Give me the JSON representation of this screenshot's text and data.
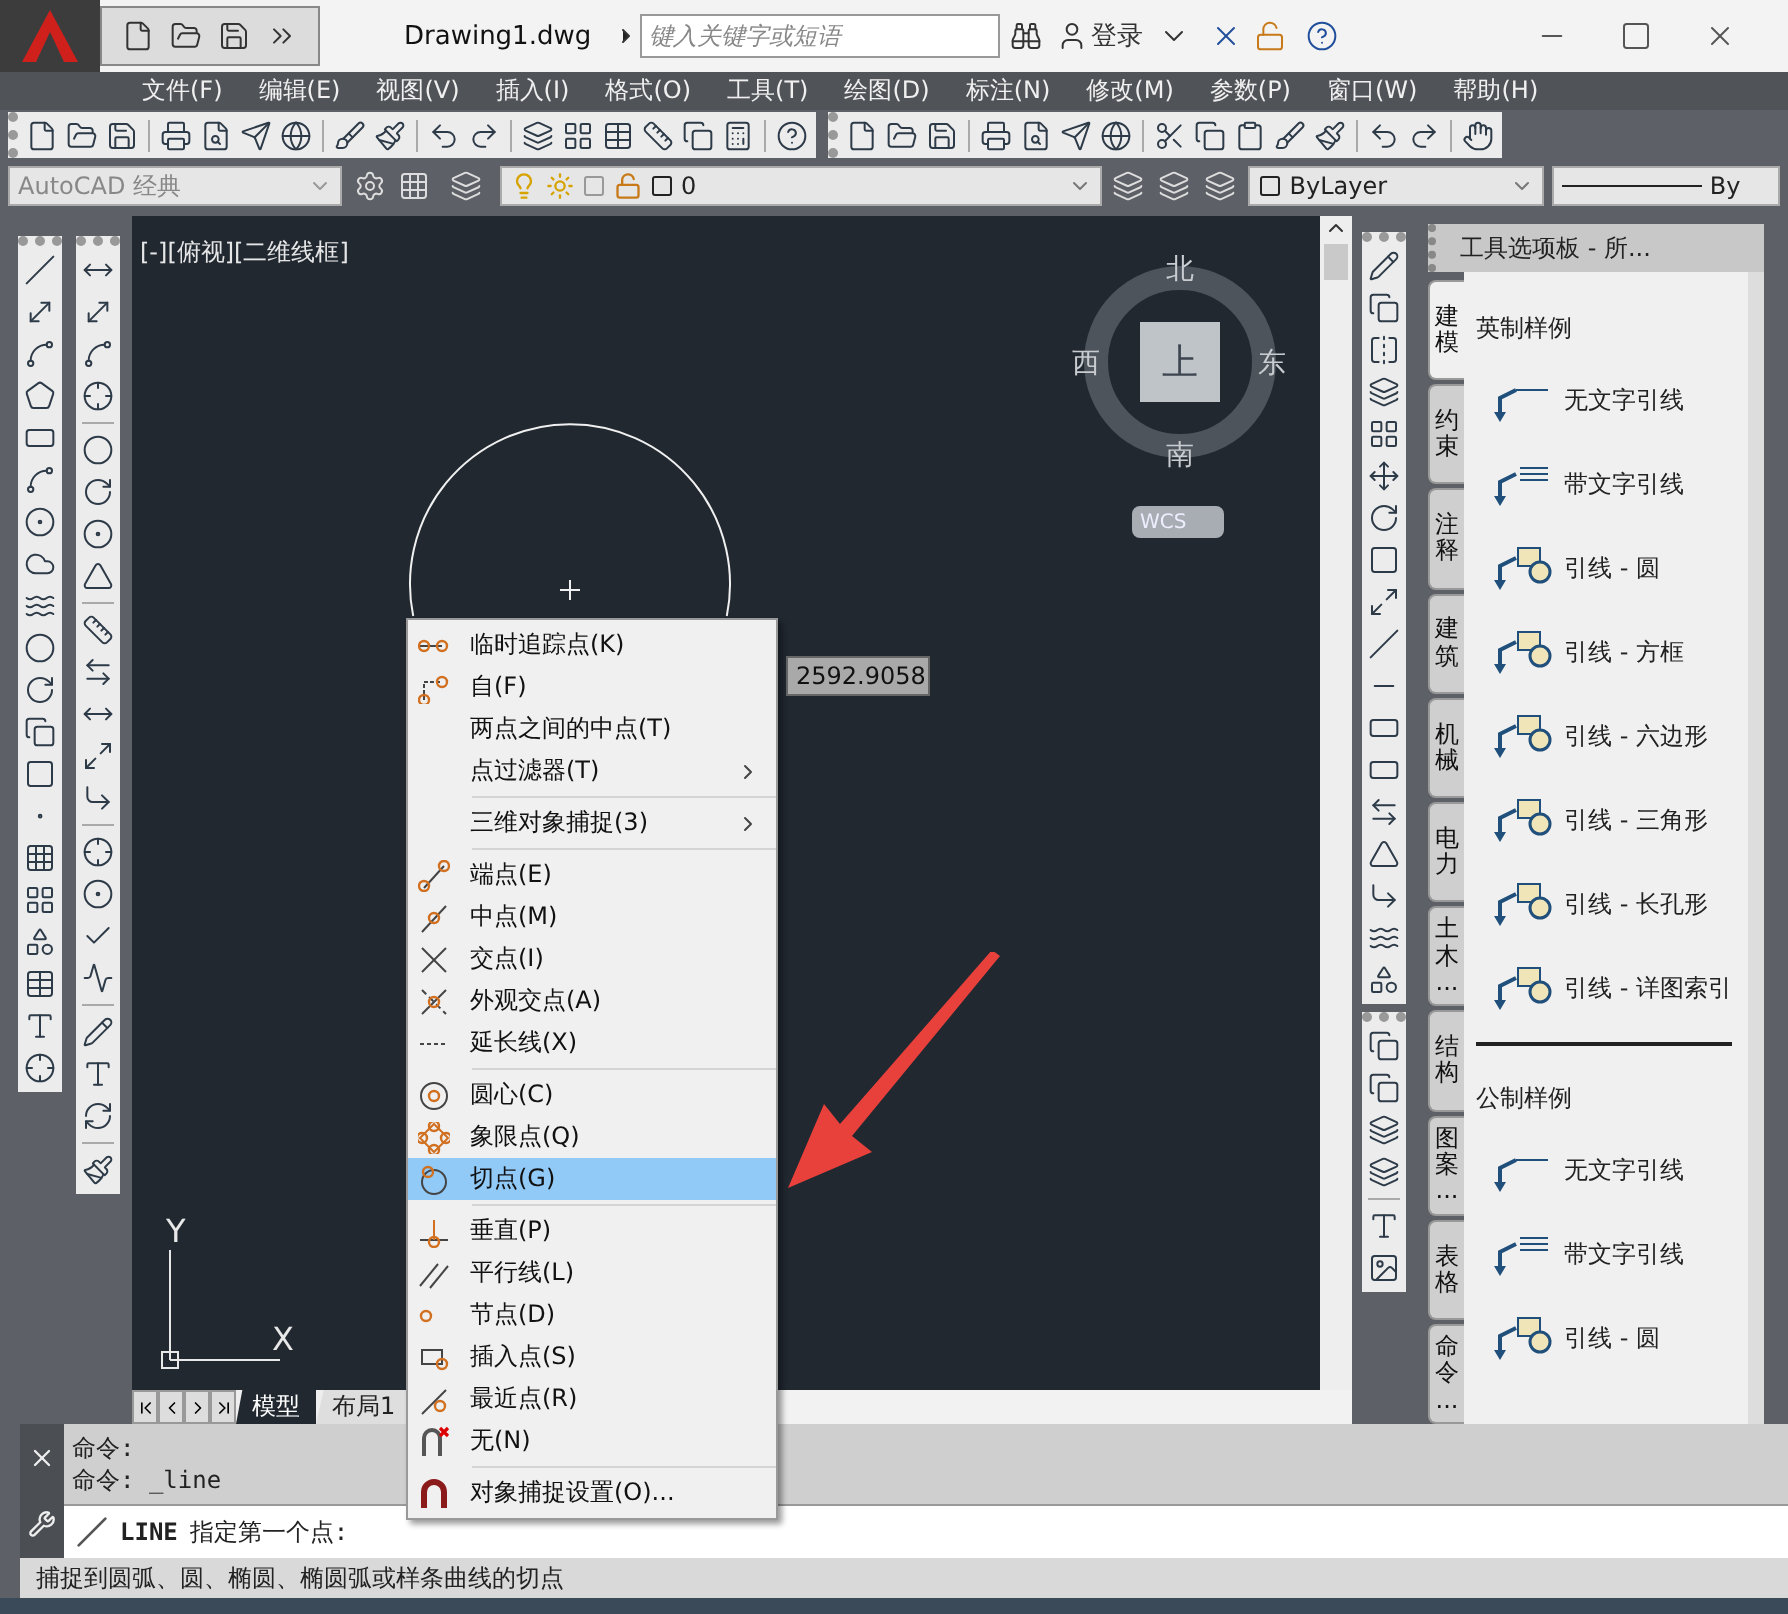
{
  "title_bar": {
    "file_name": "Drawing1.dwg",
    "search": {
      "placeholder": "键入关键字或短语"
    },
    "sign_in": "登录"
  },
  "menu_bar": [
    "文件(F)",
    "编辑(E)",
    "视图(V)",
    "插入(I)",
    "格式(O)",
    "工具(T)",
    "绘图(D)",
    "标注(N)",
    "修改(M)",
    "参数(P)",
    "窗口(W)",
    "帮助(H)"
  ],
  "properties_bar": {
    "workspace": "AutoCAD 经典",
    "layer": "0",
    "color_control": "ByLayer",
    "linetype": "By"
  },
  "viewport_label": "[-][俯视][二维线框]",
  "viewcube": {
    "north": "北",
    "south": "南",
    "west": "西",
    "east": "东",
    "face": "上",
    "coordinate_system": "WCS"
  },
  "ucs_axes": {
    "x": "X",
    "y": "Y"
  },
  "dynamic_input": "2592.9058",
  "layout_tabs": [
    {
      "label": "模型",
      "selected": true
    },
    {
      "label": "布局1",
      "selected": false
    }
  ],
  "snap_menu": [
    {
      "kind": "item",
      "label": "临时追踪点(K)",
      "submenu": false,
      "selected": false
    },
    {
      "kind": "item",
      "label": "自(F)",
      "submenu": false,
      "selected": false
    },
    {
      "kind": "item",
      "label": "两点之间的中点(T)",
      "submenu": false,
      "selected": false
    },
    {
      "kind": "item",
      "label": "点过滤器(T)",
      "submenu": true,
      "selected": false
    },
    {
      "kind": "separator"
    },
    {
      "kind": "item",
      "label": "三维对象捕捉(3)",
      "submenu": true,
      "selected": false
    },
    {
      "kind": "separator"
    },
    {
      "kind": "item",
      "label": "端点(E)",
      "submenu": false,
      "selected": false
    },
    {
      "kind": "item",
      "label": "中点(M)",
      "submenu": false,
      "selected": false
    },
    {
      "kind": "item",
      "label": "交点(I)",
      "submenu": false,
      "selected": false
    },
    {
      "kind": "item",
      "label": "外观交点(A)",
      "submenu": false,
      "selected": false
    },
    {
      "kind": "item",
      "label": "延长线(X)",
      "submenu": false,
      "selected": false
    },
    {
      "kind": "separator"
    },
    {
      "kind": "item",
      "label": "圆心(C)",
      "submenu": false,
      "selected": false
    },
    {
      "kind": "item",
      "label": "象限点(Q)",
      "submenu": false,
      "selected": false
    },
    {
      "kind": "item",
      "label": "切点(G)",
      "submenu": false,
      "selected": true
    },
    {
      "kind": "separator"
    },
    {
      "kind": "item",
      "label": "垂直(P)",
      "submenu": false,
      "selected": false
    },
    {
      "kind": "item",
      "label": "平行线(L)",
      "submenu": false,
      "selected": false
    },
    {
      "kind": "item",
      "label": "节点(D)",
      "submenu": false,
      "selected": false
    },
    {
      "kind": "item",
      "label": "插入点(S)",
      "submenu": false,
      "selected": false
    },
    {
      "kind": "item",
      "label": "最近点(R)",
      "submenu": false,
      "selected": false
    },
    {
      "kind": "item",
      "label": "无(N)",
      "submenu": false,
      "selected": false
    },
    {
      "kind": "separator"
    },
    {
      "kind": "item",
      "label": "对象捕捉设置(O)...",
      "submenu": false,
      "selected": false
    }
  ],
  "command_history": [
    "命令:",
    "命令: _line"
  ],
  "command_line": {
    "command": "LINE",
    "prompt": "指定第一个点:"
  },
  "status_text": "捕捉到圆弧、圆、椭圆、椭圆弧或样条曲线的切点",
  "tool_palette": {
    "title": "工具选项板 - 所...",
    "tabs": [
      {
        "label": "建模",
        "selected": true
      },
      {
        "label": "约束",
        "selected": false
      },
      {
        "label": "注释",
        "selected": false
      },
      {
        "label": "建筑",
        "selected": false
      },
      {
        "label": "机械",
        "selected": false
      },
      {
        "label": "电力",
        "selected": false
      },
      {
        "label": "土木...",
        "selected": false
      },
      {
        "label": "结构",
        "selected": false
      },
      {
        "label": "图案...",
        "selected": false
      },
      {
        "label": "表格",
        "selected": false
      },
      {
        "label": "命令...",
        "selected": false
      }
    ],
    "sections": [
      {
        "heading": "英制样例",
        "items": [
          {
            "kind": "leader",
            "label": "无文字引线"
          },
          {
            "kind": "text-leader",
            "label": "带文字引线"
          },
          {
            "kind": "balloon-leader",
            "label": "引线 - 圆"
          },
          {
            "kind": "balloon-leader",
            "label": "引线 - 方框"
          },
          {
            "kind": "balloon-leader",
            "label": "引线 - 六边形"
          },
          {
            "kind": "balloon-leader",
            "label": "引线 - 三角形"
          },
          {
            "kind": "balloon-leader",
            "label": "引线 - 长孔形"
          },
          {
            "kind": "balloon-leader",
            "label": "引线 - 详图索引"
          }
        ]
      },
      {
        "heading": "公制样例",
        "items": [
          {
            "kind": "leader",
            "label": "无文字引线"
          },
          {
            "kind": "text-leader",
            "label": "带文字引线"
          },
          {
            "kind": "balloon-leader",
            "label": "引线 - 圆"
          }
        ]
      }
    ]
  }
}
